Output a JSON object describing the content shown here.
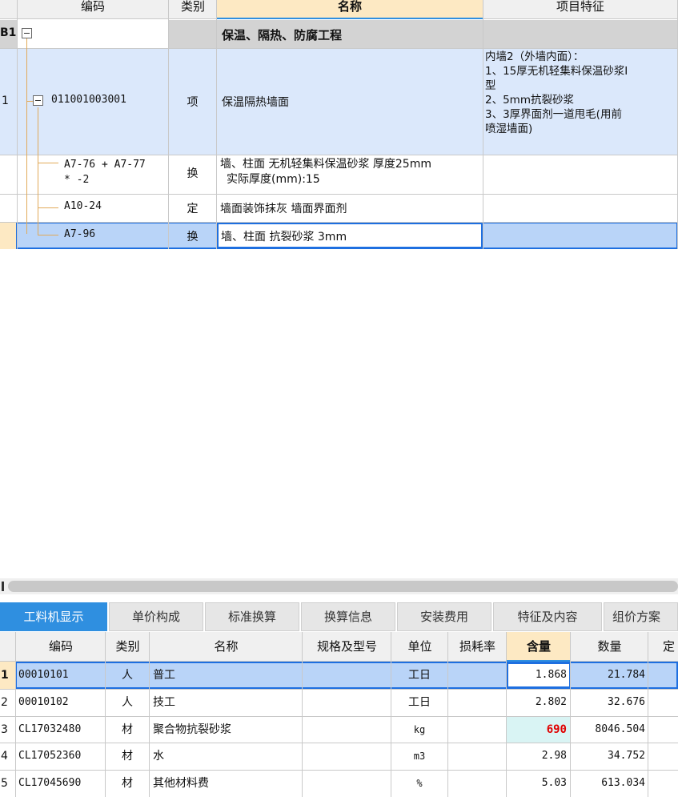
{
  "top_grid": {
    "columns": [
      "编码",
      "类别",
      "名称",
      "项目特征"
    ],
    "rows": [
      {
        "num": "B1",
        "code": "",
        "type": "",
        "name": "保温、隔热、防腐工程",
        "feature": []
      },
      {
        "num": "1",
        "code": "011001003001",
        "type": "项",
        "name": "保温隔热墙面",
        "feature": [
          "内墙2（外墙内面）：",
          "1、15厚无机轻集料保温砂浆I",
          "型",
          "2、5mm抗裂砂浆",
          "3、3厚界面剂一道甩毛(用前",
          "喷湿墙面)"
        ]
      },
      {
        "num": "",
        "code": [
          "A7-76 + A7-77",
          "* -2"
        ],
        "type": "换",
        "name": [
          "墙、柱面 无机轻集料保温砂浆 厚度25mm",
          "实际厚度(mm):15"
        ],
        "feature": []
      },
      {
        "num": "",
        "code": "A10-24",
        "type": "定",
        "name": "墙面装饰抹灰 墙面界面剂",
        "feature": []
      },
      {
        "num": "",
        "code": "A7-96",
        "type": "换",
        "name": "墙、柱面 抗裂砂浆 3mm",
        "feature": []
      }
    ]
  },
  "tabs": [
    "工料机显示",
    "单价构成",
    "标准换算",
    "换算信息",
    "安装费用",
    "特征及内容",
    "组价方案"
  ],
  "bottom_grid": {
    "columns": [
      "编码",
      "类别",
      "名称",
      "规格及型号",
      "单位",
      "损耗率",
      "含量",
      "数量",
      "定"
    ],
    "rows": [
      {
        "num": "1",
        "code": "00010101",
        "type": "人",
        "name": "普工",
        "spec": "",
        "unit": "工日",
        "loss": "",
        "content": "1.868",
        "qty": "21.784"
      },
      {
        "num": "2",
        "code": "00010102",
        "type": "人",
        "name": "技工",
        "spec": "",
        "unit": "工日",
        "loss": "",
        "content": "2.802",
        "qty": "32.676"
      },
      {
        "num": "3",
        "code": "CL17032480",
        "type": "材",
        "name": "聚合物抗裂砂浆",
        "spec": "",
        "unit": "kg",
        "loss": "",
        "content": "690",
        "qty": "8046.504"
      },
      {
        "num": "4",
        "code": "CL17052360",
        "type": "材",
        "name": "水",
        "spec": "",
        "unit": "m3",
        "loss": "",
        "content": "2.98",
        "qty": "34.752"
      },
      {
        "num": "5",
        "code": "CL17045690",
        "type": "材",
        "name": "其他材料费",
        "spec": "",
        "unit": "%",
        "loss": "",
        "content": "5.03",
        "qty": "613.034"
      }
    ]
  },
  "colors": {
    "accent": "#2f8fe0",
    "selected_row": "#dbe8fb",
    "highlight_cell": "#d9f4f4",
    "header": "#f0f0f0",
    "red_value": "#e00000"
  }
}
